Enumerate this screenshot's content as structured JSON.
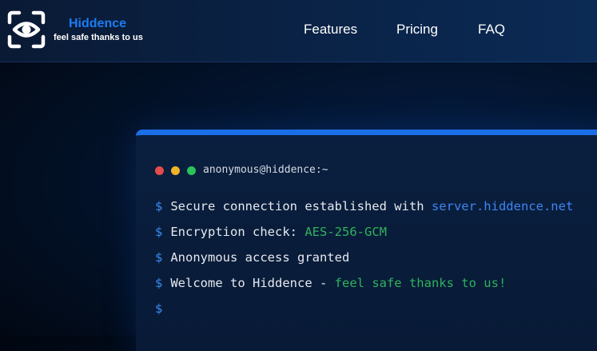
{
  "brand": {
    "name": "Hiddence",
    "tagline": "feel safe thanks to us",
    "logo_icon": "eye-scan-icon"
  },
  "nav": {
    "features": "Features",
    "pricing": "Pricing",
    "faq": "FAQ"
  },
  "terminal": {
    "title": "anonymous@hiddence:~",
    "prompt": "$",
    "lines": [
      {
        "text": "Secure connection established with",
        "highlight": "server.hiddence.net"
      },
      {
        "text": "Encryption check:",
        "highlight": "AES-256-GCM"
      },
      {
        "text": "Anonymous access granted"
      },
      {
        "text": "Welcome to Hiddence -",
        "highlight": "feel safe thanks to us!"
      }
    ]
  },
  "colors": {
    "accent": "#1a6fe8",
    "highlight_blue": "#3d86f3",
    "highlight_green": "#2fb25c",
    "dot_red": "#e54b4b",
    "dot_yellow": "#f0b429",
    "dot_green": "#29c25c"
  }
}
